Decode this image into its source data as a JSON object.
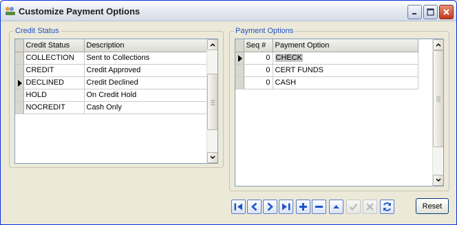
{
  "window": {
    "title": "Customize Payment Options",
    "buttons": [
      "minimize-icon",
      "maximize-icon",
      "close-icon"
    ]
  },
  "credit_status": {
    "group_label": "Credit Status",
    "columns": [
      "Credit Status",
      "Description"
    ],
    "rows": [
      {
        "status": "COLLECTION",
        "description": "Sent to Collections"
      },
      {
        "status": "CREDIT",
        "description": "Credit Approved"
      },
      {
        "status": "DECLINED",
        "description": "Credit Declined"
      },
      {
        "status": "HOLD",
        "description": "On Credit Hold"
      },
      {
        "status": "NOCREDIT",
        "description": "Cash Only"
      }
    ],
    "current_row": 2
  },
  "payment_options": {
    "group_label": "Payment Options",
    "columns": [
      "Seq #",
      "Payment Option"
    ],
    "rows": [
      {
        "seq": "0",
        "option": "CHECK"
      },
      {
        "seq": "0",
        "option": "CERT FUNDS"
      },
      {
        "seq": "0",
        "option": "CASH"
      }
    ],
    "current_row": 0,
    "selected_cell": "CHECK"
  },
  "navigator": {
    "buttons": [
      "first-record-icon",
      "prior-record-icon",
      "next-record-icon",
      "last-record-icon",
      "insert-icon",
      "delete-icon",
      "edit-icon",
      "post-icon",
      "cancel-icon",
      "refresh-icon"
    ]
  },
  "reset_label": "Reset",
  "colors": {
    "group_label": "#2050c8",
    "navigator_icon": "#1f55c9",
    "close_button": "#c0391b"
  }
}
